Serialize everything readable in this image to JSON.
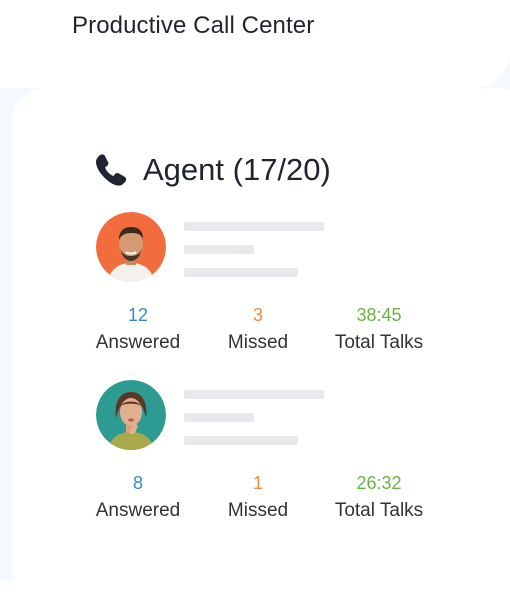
{
  "header": {
    "title": "Productive Call Center"
  },
  "card": {
    "title": "Agent (17/20)",
    "icon": "phone-icon"
  },
  "agents": [
    {
      "answered": {
        "value": "12",
        "label": "Answered"
      },
      "missed": {
        "value": "3",
        "label": "Missed"
      },
      "talks": {
        "value": "38:45",
        "label": "Total Talks"
      }
    },
    {
      "answered": {
        "value": "8",
        "label": "Answered"
      },
      "missed": {
        "value": "1",
        "label": "Missed"
      },
      "talks": {
        "value": "26:32",
        "label": "Total Talks"
      }
    }
  ],
  "colors": {
    "answered": "#3a86d1",
    "missed": "#f08a3c",
    "talks": "#6cb23f",
    "background": "#f3f9fe",
    "avatar1_bg": "#f26d3d",
    "avatar2_bg": "#2e9b92"
  }
}
